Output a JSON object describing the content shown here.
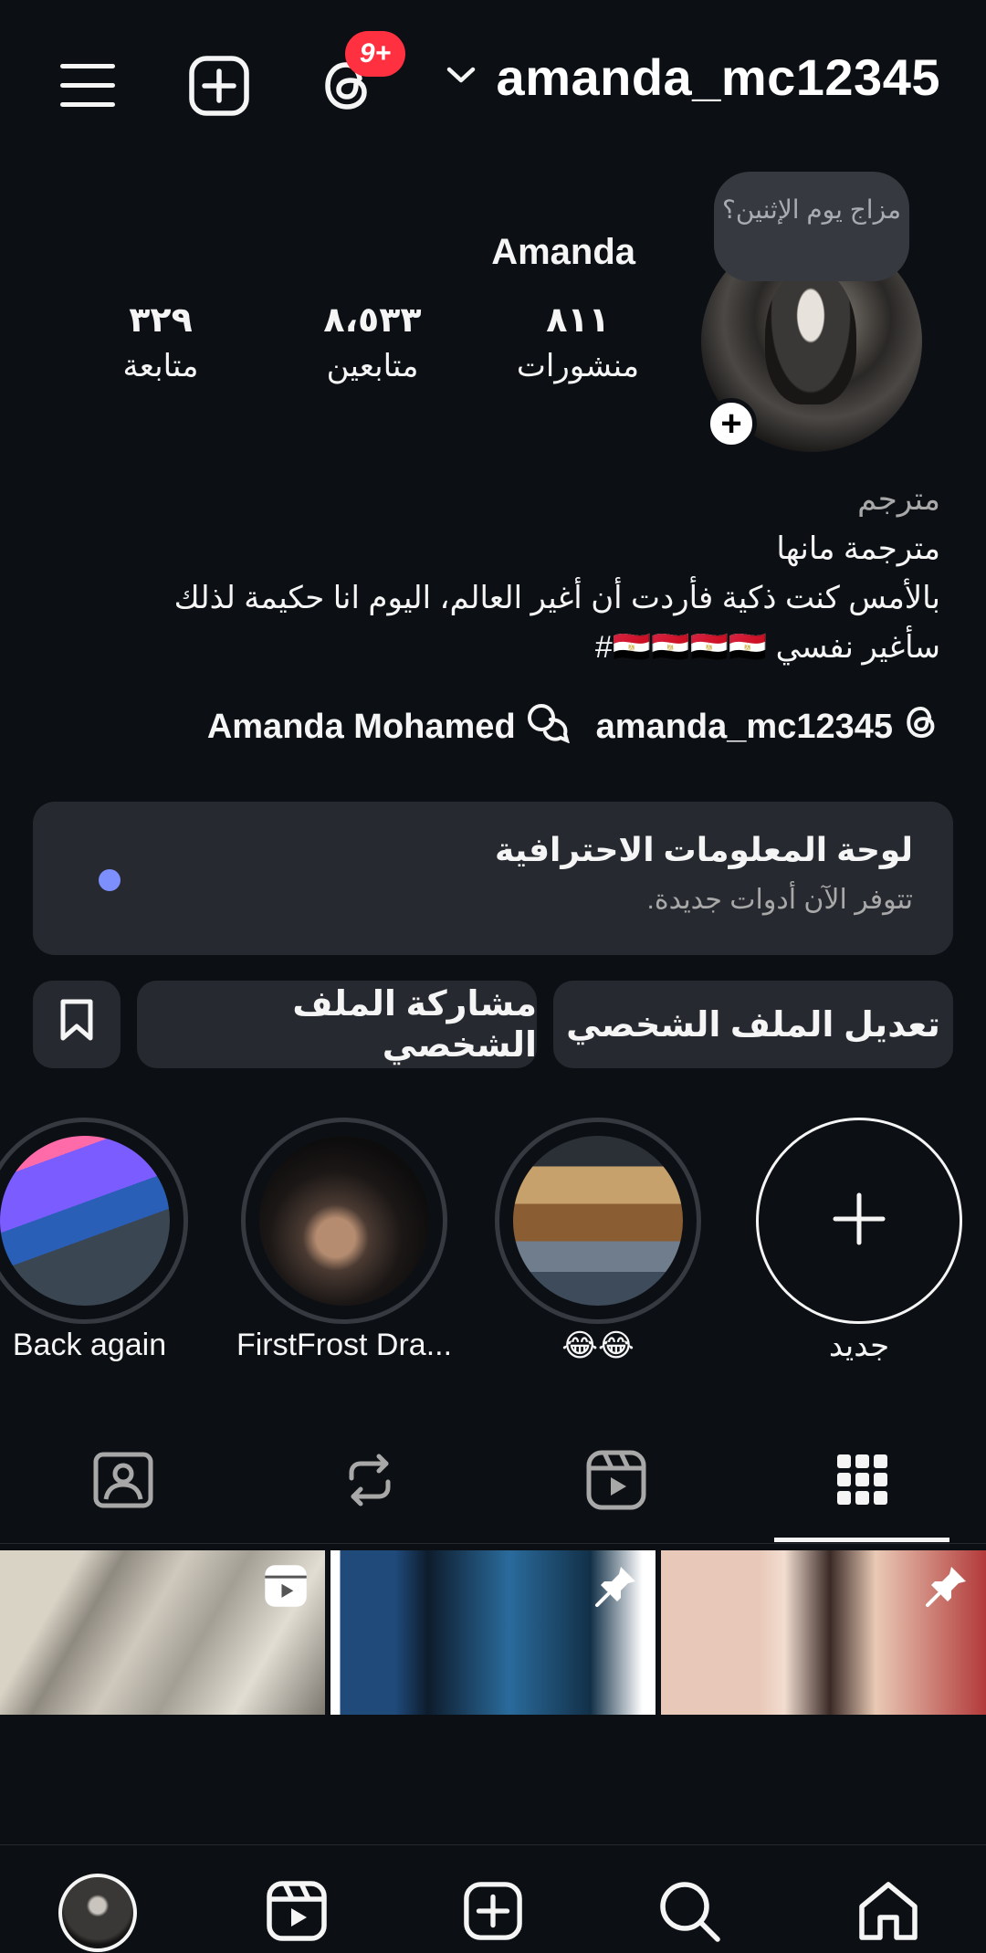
{
  "header": {
    "username": "amanda_mc12345",
    "notification_badge": "9+"
  },
  "profile": {
    "mood_note": "مزاج يوم الإثنين؟",
    "display_name": "Amanda",
    "stats": {
      "posts_value": "٨١١",
      "posts_label": "منشورات",
      "followers_value": "٨،٥٣٣",
      "followers_label": "متابعين",
      "following_value": "٣٢٩",
      "following_label": "متابعة"
    },
    "bio": {
      "category": "مترجم",
      "line1": "مترجمة مانها",
      "line2": "بالأمس كنت ذكية فأردت أن أغير العالم، اليوم انا حكيمة لذلك",
      "line3": "سأغير نفسي 🇪🇬🇪🇬🇪🇬🇪🇬#"
    },
    "threads_link": "amanda_mc12345",
    "linked_profile": "Amanda Mohamed"
  },
  "dashboard": {
    "title": "لوحة المعلومات الاحترافية",
    "subtitle": "تتوفر الآن أدوات جديدة.",
    "dot_color": "#7c8ffc"
  },
  "actions": {
    "edit_profile": "تعديل الملف الشخصي",
    "share_profile": "مشاركة الملف الشخصي"
  },
  "highlights": {
    "new_label": "جديد",
    "items": [
      {
        "label": "😂😂"
      },
      {
        "label": "FirstFrost Dra..."
      },
      {
        "label": "Back again"
      }
    ]
  },
  "colors": {
    "background": "#0c1014",
    "surface": "#262a30",
    "badge": "#ff3040",
    "text": "#f5f5f5",
    "muted": "#a8a8a8"
  }
}
